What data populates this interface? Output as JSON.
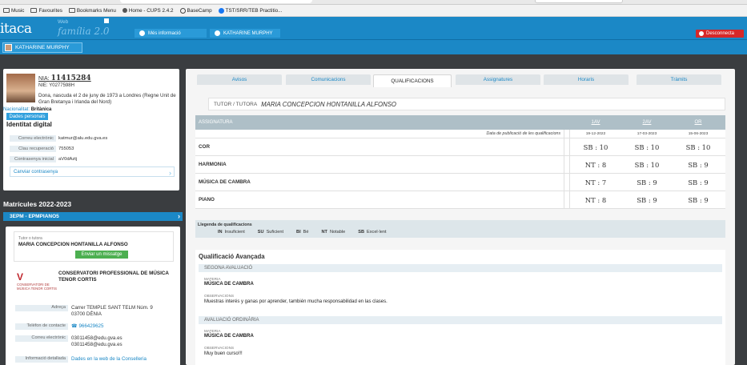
{
  "bookmarks": [
    {
      "label": "Music",
      "icon": "folder-icon"
    },
    {
      "label": "Favourites",
      "icon": "folder-icon"
    },
    {
      "label": "Bookmarks Menu",
      "icon": "folder-icon"
    },
    {
      "label": "Home - CUPS 2.4.2",
      "icon": "printer-icon"
    },
    {
      "label": "BaseCamp",
      "icon": "globe-icon"
    },
    {
      "label": "TST/SRR/TEB Practitio...",
      "icon": "facebook-icon"
    }
  ],
  "header": {
    "logo": "itaca",
    "web": "Web",
    "familia": "família 2.0",
    "more_info": "Més informació",
    "student_tab": "KATHARINE MURPHY",
    "logout": "Desconnecta"
  },
  "user_strip": {
    "name": "KATHARINE MURPHY"
  },
  "profile": {
    "nia_label": "NIA:",
    "nia": "11415284",
    "nie": "NIE: Y0277598H",
    "birth": "Dona, nascuda el 2 de juny de 1973 a Londres (Regne Unit de Gran Bretanya i Irlanda del Nord)",
    "nationality_label": "Nacionalitat:",
    "nationality": "Britànica",
    "personal_btn": "Dades personals",
    "digital_title": "Identitat digital",
    "email_label": "Correu electrònic",
    "email": "katmur@alu.edu.gva.es",
    "recovery_label": "Clau recuperació",
    "recovery": "755053",
    "initpwd_label": "Contrasenya inicial",
    "initpwd": "aV0dAztj",
    "change_pwd": "Canviar contrasenya"
  },
  "enrolments": {
    "title": "Matrícules 2022-2023",
    "course": "3EPM - EPMPIANO5"
  },
  "centre": {
    "tutor_label": "Tutor o tutora",
    "tutor_name": "MARIA CONCEPCION HONTANILLA ALFONSO",
    "send_msg": "Enviar un missatge",
    "logo_text": "CONSERVATORI DE MÚSICA TENOR CORTIS",
    "name_line1": "CONSERVATORI PROFESSIONAL DE MÚSICA",
    "name_line2": "TENOR CORTIS",
    "address_label": "Adreça",
    "address_line1": "Carrer TEMPLE SANT TELM Núm. 9",
    "address_line2": "03700 DÉNIA",
    "phone_label": "Telèfon de contacte",
    "phone": "966429625",
    "email_label": "Correu electrònic",
    "email1": "03011458@edu.gva.es",
    "email2": "03011458@edu.gva.es",
    "info_label": "Informació detallada",
    "info_link": "Dades en la web de la Conselleria"
  },
  "tabs": [
    "Avisos",
    "Comunicacions",
    "QUALIFICACIONS",
    "Assignatures",
    "Horaris",
    "Tràmits"
  ],
  "active_tab": "QUALIFICACIONS",
  "tutor_bar": {
    "label": "TUTOR / TUTORA",
    "name": "MARIA CONCEPCION HONTANILLA ALFONSO"
  },
  "grades": {
    "col_subject": "ASSIGNATURA",
    "evals": [
      "1AV",
      "2AV",
      "OR"
    ],
    "pub_label": "Data de publicació de les qualificacions",
    "pub_dates": [
      "19-12-2022",
      "17-03-2023",
      "15-06-2023"
    ],
    "rows": [
      {
        "subject": "COR",
        "marks": [
          "SB : 10",
          "SB : 10",
          "SB : 10"
        ]
      },
      {
        "subject": "HARMONIA",
        "marks": [
          "NT : 8",
          "SB : 10",
          "SB : 9"
        ]
      },
      {
        "subject": "MÚSICA DE CAMBRA",
        "marks": [
          "NT : 7",
          "SB : 9",
          "SB : 9"
        ]
      },
      {
        "subject": "PIANO",
        "marks": [
          "NT : 8",
          "SB : 9",
          "SB : 9"
        ]
      }
    ]
  },
  "legend": {
    "title": "Llegenda de qualificacions",
    "items": [
      {
        "code": "IN",
        "label": "Insuficient"
      },
      {
        "code": "SU",
        "label": "Suficient"
      },
      {
        "code": "BI",
        "label": "Bé"
      },
      {
        "code": "NT",
        "label": "Notable"
      },
      {
        "code": "SB",
        "label": "Excel·lent"
      }
    ]
  },
  "advanced": {
    "title": "Qualificació Avançada",
    "sec1": "SEGONA AVALUACIÓ",
    "sec1_mat_label": "MATERIA",
    "sec1_mat": "MÚSICA DE CAMBRA",
    "sec1_obs_label": "OBSERVACIONS",
    "sec1_obs": "Muestras interés y ganas por aprender, también mucha responsabilidad en las clases.",
    "sec2": "AVALUACIÓ ORDINÀRIA",
    "sec2_mat_label": "MATERIA",
    "sec2_mat": "MÚSICA DE CAMBRA",
    "sec2_obs_label": "OBSERVACIONS",
    "sec2_obs": "Muy buen curso!!!"
  }
}
